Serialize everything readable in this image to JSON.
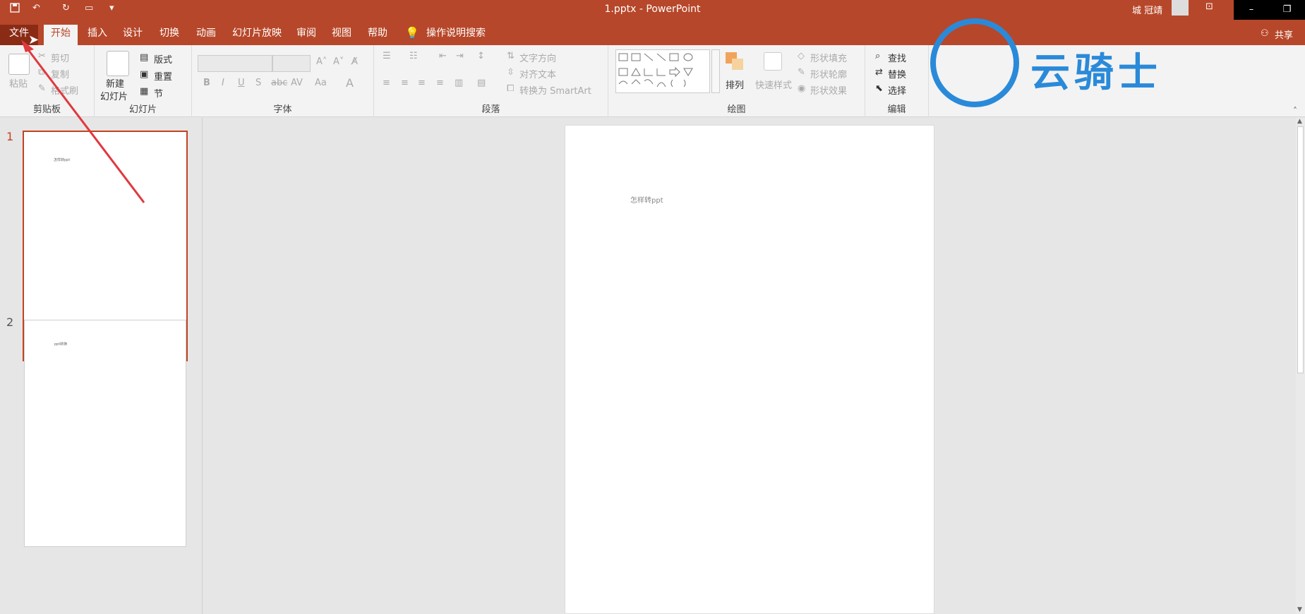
{
  "title_bar": {
    "title": "1.pptx  -  PowerPoint",
    "user": "城 冠靖",
    "qat": [
      "save-icon",
      "undo-icon",
      "redo-icon",
      "present-icon",
      "customize-icon"
    ],
    "window_controls": {
      "minimize": "–",
      "restore": "❐"
    }
  },
  "tabs": {
    "file": "文件",
    "home": "开始",
    "insert": "插入",
    "design": "设计",
    "transitions": "切换",
    "animations": "动画",
    "slideshow": "幻灯片放映",
    "review": "审阅",
    "view": "视图",
    "help": "帮助",
    "search": "操作说明搜索",
    "share": "共享"
  },
  "ribbon": {
    "clipboard": {
      "paste": "粘贴",
      "cut": "剪切",
      "copy": "复制",
      "format_painter": "格式刷",
      "label": "剪贴板"
    },
    "slides": {
      "new_slide_1": "新建",
      "new_slide_2": "幻灯片",
      "layout": "版式",
      "reset": "重置",
      "section": "节",
      "label": "幻灯片"
    },
    "font": {
      "label": "字体",
      "bold": "B",
      "italic": "I",
      "underline": "U",
      "strike": "S",
      "abc": "abc",
      "av": "AV",
      "aa": "Aa",
      "a": "A"
    },
    "paragraph": {
      "text_direction": "文字方向",
      "align_text": "对齐文本",
      "smartart": "转换为 SmartArt",
      "label": "段落"
    },
    "drawing": {
      "arrange": "排列",
      "quick_styles": "快速样式",
      "shape_fill": "形状填充",
      "shape_outline": "形状轮廓",
      "shape_effects": "形状效果",
      "label": "绘图"
    },
    "editing": {
      "find": "查找",
      "replace": "替换",
      "select": "选择",
      "label": "编辑"
    }
  },
  "thumbnails": [
    {
      "number": "1",
      "text": "怎样转ppt"
    },
    {
      "number": "2",
      "text": "ppt转换"
    }
  ],
  "slide": {
    "text": "怎样转ppt"
  },
  "watermark": {
    "text": "云骑士"
  },
  "colors": {
    "accent": "#b7472a",
    "file_tab": "#8a2b16",
    "selection": "#c2431f",
    "annotation_arrow": "#e0393e",
    "watermark": "#2a8ad9"
  }
}
